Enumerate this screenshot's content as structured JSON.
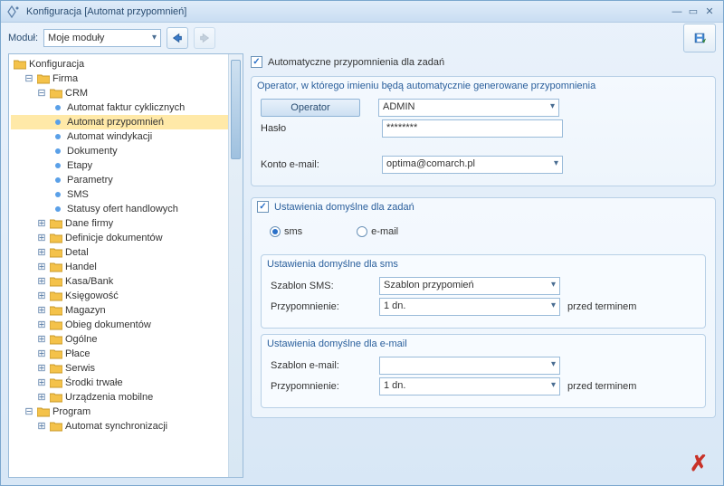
{
  "window": {
    "title": "Konfiguracja [Automat przypomnień]"
  },
  "topbar": {
    "modul_label": "Moduł:",
    "modul_value": "Moje moduły"
  },
  "tree": {
    "root": "Konfiguracja",
    "firma": "Firma",
    "crm": "CRM",
    "crm_children": [
      "Automat faktur cyklicznych",
      "Automat przypomnień",
      "Automat windykacji",
      "Dokumenty",
      "Etapy",
      "Parametry",
      "SMS",
      "Statusy ofert handlowych"
    ],
    "firma_children": [
      "Dane firmy",
      "Definicje dokumentów",
      "Detal",
      "Handel",
      "Kasa/Bank",
      "Księgowość",
      "Magazyn",
      "Obieg dokumentów",
      "Ogólne",
      "Płace",
      "Serwis",
      "Środki trwałe",
      "Urządzenia mobilne"
    ],
    "program": "Program",
    "program_children": [
      "Automat synchronizacji"
    ]
  },
  "main": {
    "auto_remind_label": "Automatyczne przypomnienia dla zadań",
    "operator_group": "Operator, w którego imieniu będą automatycznie generowane przypomnienia",
    "operator_btn": "Operator",
    "operator_value": "ADMIN",
    "password_label": "Hasło",
    "password_value": "********",
    "email_label": "Konto e-mail:",
    "email_value": "optima@comarch.pl",
    "defaults_group": "Ustawienia domyślne dla zadań",
    "radio_sms": "sms",
    "radio_email": "e-mail",
    "sms_group": "Ustawienia domyślne dla sms",
    "sms_template_label": "Szablon SMS:",
    "sms_template_value": "Szablon przypomień",
    "reminder_label": "Przypomnienie:",
    "reminder_value": "1 dn.",
    "after_label": "przed terminem",
    "email_group": "Ustawienia domyślne dla e-mail",
    "email_template_label": "Szablon e-mail:",
    "email_template_value": ""
  }
}
